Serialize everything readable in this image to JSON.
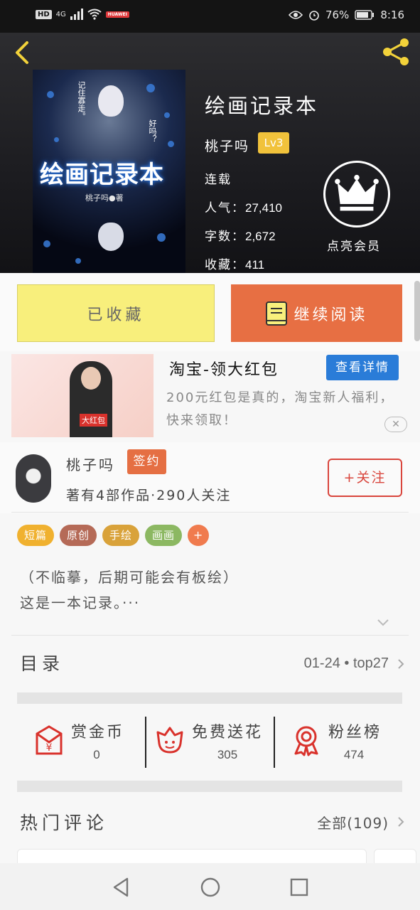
{
  "status_bar": {
    "network": "HD",
    "signal": "4G",
    "app_badge": "HUAWEI",
    "battery": "76%",
    "time": "8:16"
  },
  "book": {
    "title": "绘画记录本",
    "author": "桃子吗",
    "level": "Lv3",
    "status": "连载",
    "popularity_label": "人气：",
    "popularity": "27,410",
    "word_count_label": "字数：",
    "word_count": "2,672",
    "collections_label": "收藏：",
    "collections": "411",
    "vip_label": "点亮会员",
    "cover": {
      "title": "绘画记录本",
      "author": "桃子吗●著",
      "side_text_1": "记住寡走。",
      "side_text_2": "好吗？"
    }
  },
  "actions": {
    "collected_label": "已收藏",
    "continue_label": "继续阅读"
  },
  "ad": {
    "title": "淘宝-领大红包",
    "button": "查看详情",
    "description": "200元红包是真的，淘宝新人福利，快来领取！",
    "image_text": "大红包"
  },
  "author_info": {
    "name": "桃子吗",
    "badge": "签约",
    "stats": "著有4部作品·290人关注",
    "follow_label": "+关注"
  },
  "tags": [
    {
      "label": "短篇",
      "color": "#f0b12f"
    },
    {
      "label": "原创",
      "color": "#b56a57"
    },
    {
      "label": "手绘",
      "color": "#d9a23a"
    },
    {
      "label": "画画",
      "color": "#8cb862"
    },
    {
      "label": "+",
      "color": "#f07b4e"
    }
  ],
  "description": {
    "line1": "（不临摹，后期可能会有板绘）",
    "line2": "这是一本记录。···"
  },
  "catalog": {
    "title": "目录",
    "info": "01-24 • top27"
  },
  "stats": [
    {
      "label": "赏金币",
      "value": "0",
      "icon": "red-envelope-icon"
    },
    {
      "label": "免费送花",
      "value": "305",
      "icon": "flower-icon"
    },
    {
      "label": "粉丝榜",
      "value": "474",
      "icon": "medal-icon"
    }
  ],
  "comments": {
    "title": "热门评论",
    "all_label": "全部(109)"
  },
  "colors": {
    "accent_orange": "#e76f43",
    "fav_yellow": "#f8ef7c",
    "ad_blue": "#2a7cd8",
    "follow_red": "#d9453c",
    "icon_red": "#d9322c"
  }
}
